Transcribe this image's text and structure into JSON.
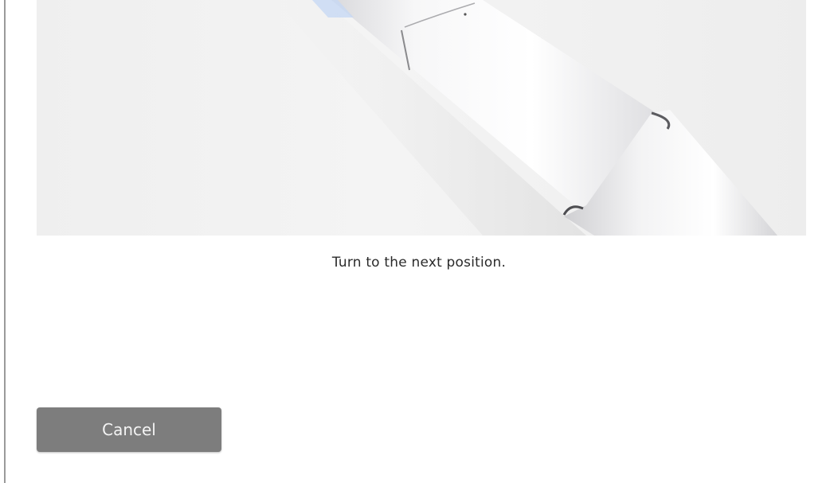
{
  "instruction": {
    "text": "Turn to the next position."
  },
  "actions": {
    "cancel_label": "Cancel"
  },
  "illustration": {
    "subject": "cylindrical-device"
  },
  "colors": {
    "button_bg": "#7d7d7d",
    "button_text": "#f4f4f4",
    "illustration_bg": "#f1f1f1"
  }
}
